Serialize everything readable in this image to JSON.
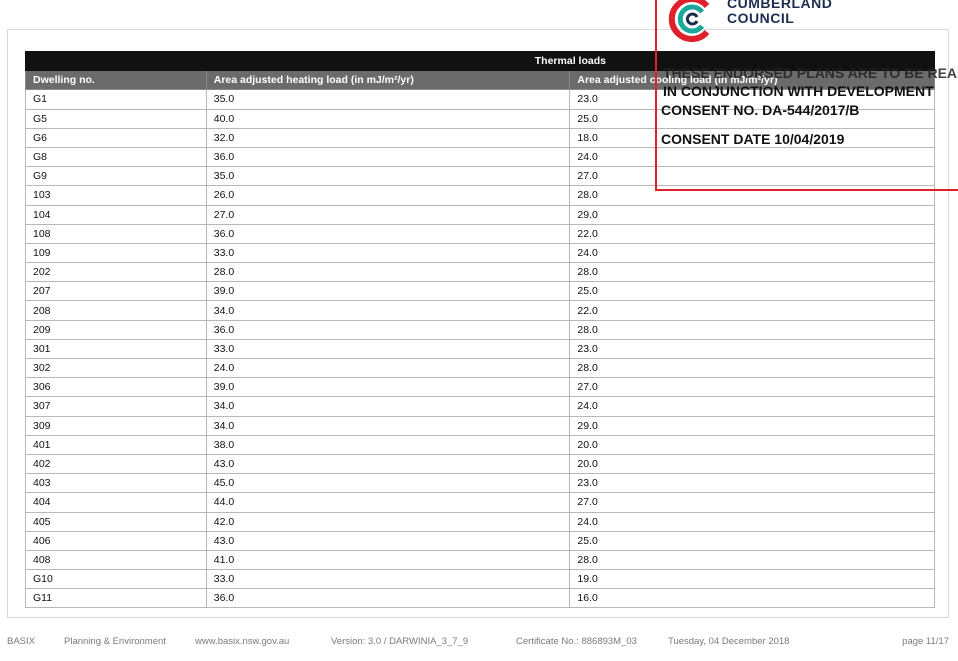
{
  "stamp": {
    "council_line1": "CUMBERLAND",
    "council_line2": "COUNCIL",
    "endorse_line1": "THESE ENDORSED PLANS ARE TO BE READ",
    "endorse_line2": "IN CONJUNCTION WITH DEVELOPMENT",
    "consent_no": "CONSENT NO. DA-544/2017/B",
    "consent_date": "CONSENT DATE 10/04/2019",
    "colors": {
      "border": "#e0202a",
      "logo_red": "#e0202a",
      "logo_teal": "#1aa89a",
      "logo_navy": "#1c2d4f"
    }
  },
  "table": {
    "group_header": "Thermal loads",
    "columns": [
      "Dwelling no.",
      "Area adjusted heating load (in mJ/m²/yr)",
      "Area adjusted cooling load (in mJ/m²/yr)"
    ],
    "rows": [
      [
        "G1",
        "35.0",
        "23.0"
      ],
      [
        "G5",
        "40.0",
        "25.0"
      ],
      [
        "G6",
        "32.0",
        "18.0"
      ],
      [
        "G8",
        "36.0",
        "24.0"
      ],
      [
        "G9",
        "35.0",
        "27.0"
      ],
      [
        "103",
        "26.0",
        "28.0"
      ],
      [
        "104",
        "27.0",
        "29.0"
      ],
      [
        "108",
        "36.0",
        "22.0"
      ],
      [
        "109",
        "33.0",
        "24.0"
      ],
      [
        "202",
        "28.0",
        "28.0"
      ],
      [
        "207",
        "39.0",
        "25.0"
      ],
      [
        "208",
        "34.0",
        "22.0"
      ],
      [
        "209",
        "36.0",
        "28.0"
      ],
      [
        "301",
        "33.0",
        "23.0"
      ],
      [
        "302",
        "24.0",
        "28.0"
      ],
      [
        "306",
        "39.0",
        "27.0"
      ],
      [
        "307",
        "34.0",
        "24.0"
      ],
      [
        "309",
        "34.0",
        "29.0"
      ],
      [
        "401",
        "38.0",
        "20.0"
      ],
      [
        "402",
        "43.0",
        "20.0"
      ],
      [
        "403",
        "45.0",
        "23.0"
      ],
      [
        "404",
        "44.0",
        "27.0"
      ],
      [
        "405",
        "42.0",
        "24.0"
      ],
      [
        "406",
        "43.0",
        "25.0"
      ],
      [
        "408",
        "41.0",
        "28.0"
      ],
      [
        "G10",
        "33.0",
        "19.0"
      ],
      [
        "G11",
        "36.0",
        "16.0"
      ]
    ]
  },
  "footer": {
    "basix": "BASIX",
    "dept": "Planning & Environment",
    "url": "www.basix.nsw.gov.au",
    "version": "Version: 3.0 / DARWINIA_3_7_9",
    "certificate": "Certificate No.: 886893M_03",
    "date": "Tuesday, 04 December 2018",
    "page": "page 11/17"
  }
}
